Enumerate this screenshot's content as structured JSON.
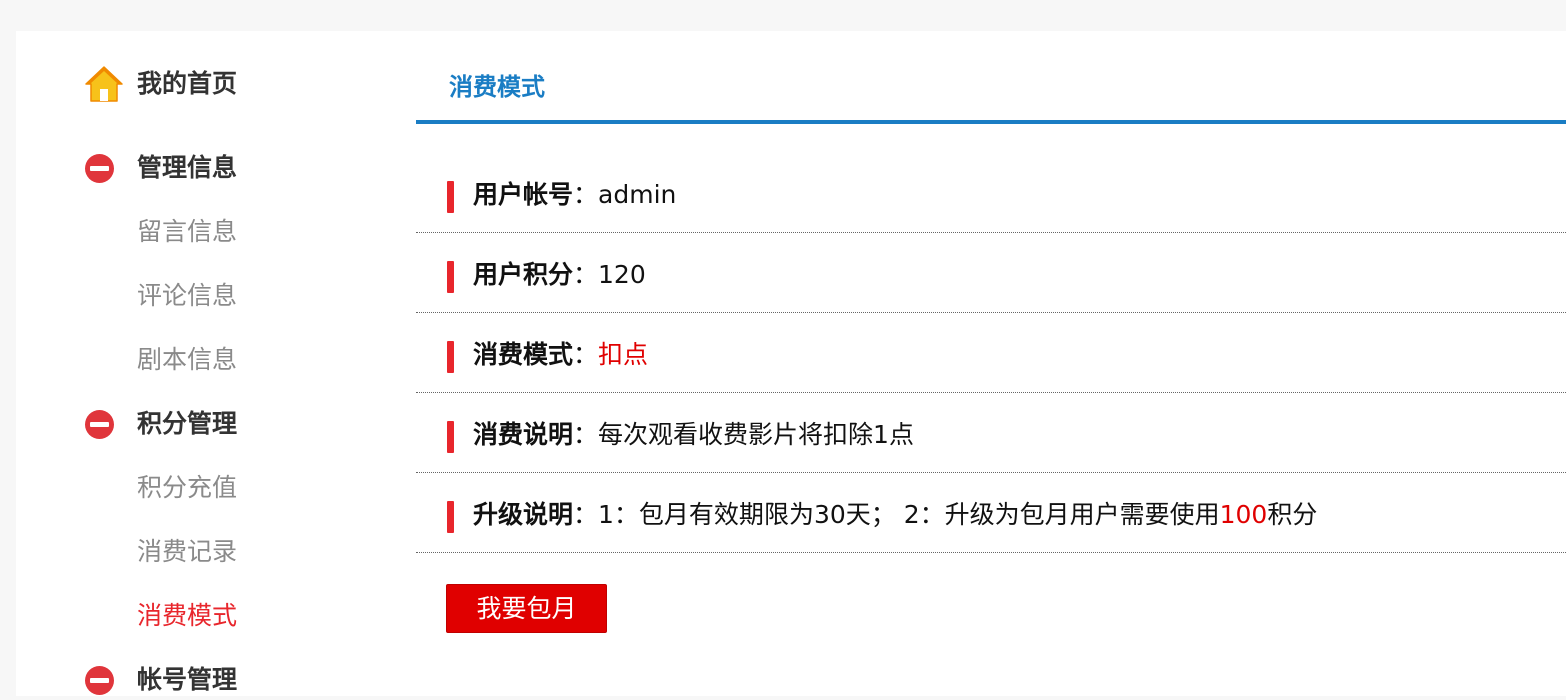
{
  "sidebar": {
    "home": {
      "label": "我的首页",
      "icon": "home-icon"
    },
    "groups": [
      {
        "label": "管理信息",
        "icon": "minus-circle-icon",
        "items": [
          {
            "label": "留言信息"
          },
          {
            "label": "评论信息"
          },
          {
            "label": "剧本信息"
          }
        ]
      },
      {
        "label": "积分管理",
        "icon": "minus-circle-icon",
        "items": [
          {
            "label": "积分充值"
          },
          {
            "label": "消费记录"
          },
          {
            "label": "消费模式",
            "active": true
          }
        ]
      },
      {
        "label": "帐号管理",
        "icon": "minus-circle-icon",
        "items": []
      }
    ]
  },
  "main": {
    "title": "消费模式",
    "rows": [
      {
        "key": "用户帐号",
        "sep": "：",
        "value": "admin"
      },
      {
        "key": "用户积分",
        "sep": "：",
        "value": "120"
      },
      {
        "key": "消费模式",
        "sep": "：",
        "value": "扣点"
      },
      {
        "key": "消费说明",
        "sep": "：",
        "value": "每次观看收费影片将扣除1点"
      },
      {
        "key": "升级说明",
        "sep": "：",
        "value_pre": "1：包月有效期限为30天； 2：升级为包月用户需要使用",
        "value_highlight": "100",
        "value_post": "积分"
      }
    ],
    "button_label": "我要包月"
  },
  "colors": {
    "accent_blue": "#1a7dc4",
    "accent_red": "#e8262c",
    "button_red": "#e00000",
    "highlight_red": "#e00000"
  }
}
